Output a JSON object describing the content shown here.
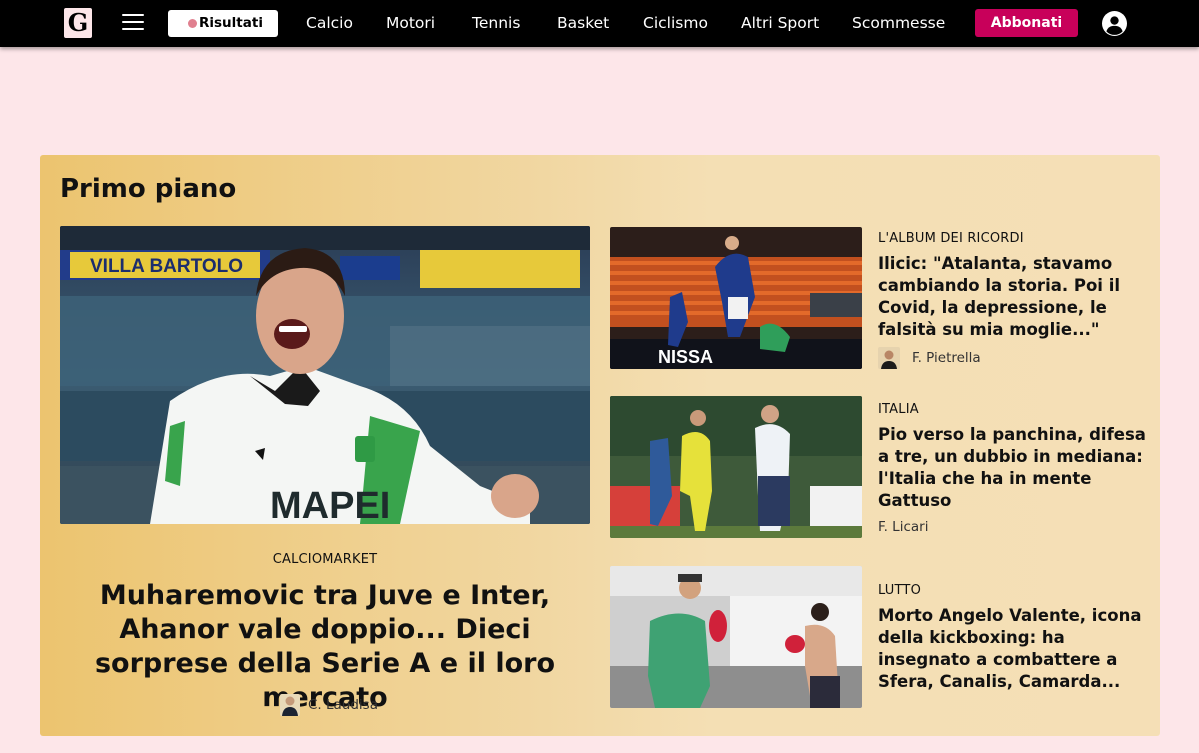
{
  "header": {
    "logo_letter": "G",
    "results_label": "Risultati",
    "nav": [
      "Calcio",
      "Motori",
      "Tennis",
      "Basket",
      "Ciclismo",
      "Altri Sport",
      "Scommesse"
    ],
    "subscribe_label": "Abbonati"
  },
  "section": {
    "title": "Primo piano"
  },
  "hero": {
    "category": "CALCIOMARKET",
    "title": "Muharemovic tra Juve e Inter, Ahanor vale doppio... Dieci sorprese della Serie A e il loro mercato",
    "author": "C. Laudisa",
    "image_text": {
      "banner": "VILLA BARTOLO",
      "sponsor": "MAPEI"
    }
  },
  "articles": [
    {
      "category": "L'ALBUM DEI RICORDI",
      "title": "Ilicic: \"Atalanta, stavamo cambiando la storia. Poi il Covid, la depressione, le falsità su mia moglie...\"",
      "author": "F. Pietrella",
      "image_text": "NISSA"
    },
    {
      "category": "ITALIA",
      "title": "Pio verso la panchina, difesa a tre, un dubbio in mediana: l'Italia che ha in mente Gattuso",
      "author": "F. Licari"
    },
    {
      "category": "LUTTO",
      "title": "Morto Angelo Valente, icona della kickboxing: ha insegnato a combattere a Sfera, Canalis, Camarda...",
      "author": ""
    }
  ],
  "colors": {
    "topbar": "#000000",
    "page_bg": "#fde6e9",
    "accent": "#c8005a",
    "box_gradient_start": "#ecc46f",
    "box_gradient_end": "#f5dfb6"
  }
}
